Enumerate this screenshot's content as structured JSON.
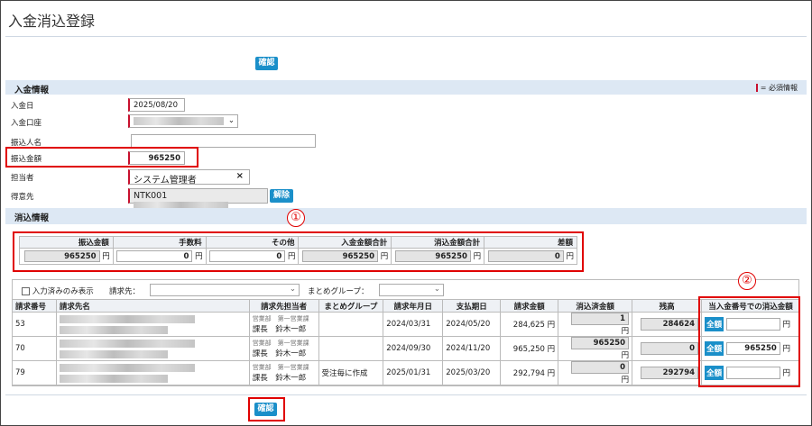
{
  "page_title": "入金消込登録",
  "confirm_label": "確認",
  "payment_section": {
    "title": "入金情報",
    "required_legend": "= 必須情報",
    "fields": {
      "date_label": "入金日",
      "date_value": "2025/08/20",
      "account_label": "入金口座",
      "payer_label": "振込人名",
      "amount_label": "振込金額",
      "amount_value": "965250",
      "staff_label": "担当者",
      "staff_value": "システム管理者",
      "staff_clear": "×",
      "customer_label": "得意先",
      "customer_code": "NTK001",
      "release_label": "解除"
    }
  },
  "clearing_section": {
    "title": "消込情報",
    "summary": {
      "headers": [
        "振込金額",
        "手数料",
        "その他",
        "入金金額合計",
        "消込金額合計",
        "差額"
      ],
      "values": [
        "965250",
        "0",
        "0",
        "965250",
        "965250",
        "0"
      ],
      "unit": "円"
    },
    "filters": {
      "only_entered_label": "入力済みのみ表示",
      "billing_to_label": "請求先：",
      "group_label": "まとめグループ："
    },
    "columns": [
      "請求番号",
      "請求先名",
      "請求先担当者",
      "まとめグループ",
      "請求年月日",
      "支払期日",
      "請求金額",
      "消込済金額",
      "残高",
      "当入金番号での消込金額"
    ],
    "rows": [
      {
        "no": "53",
        "dept": "営業部　第一営業課",
        "person": "課長　鈴木一郎",
        "group": "",
        "bill_date": "2024/03/31",
        "due_date": "2024/05/20",
        "amount": "284,625 円",
        "cleared": "1",
        "balance": "284624",
        "this_amount": ""
      },
      {
        "no": "70",
        "dept": "営業部　第一営業課",
        "person": "課長　鈴木一郎",
        "group": "",
        "bill_date": "2024/09/30",
        "due_date": "2024/11/20",
        "amount": "965,250 円",
        "cleared": "965250",
        "balance": "0",
        "this_amount": "965250"
      },
      {
        "no": "79",
        "dept": "営業部　第一営業課",
        "person": "課長　鈴木一郎",
        "group": "受注毎に作成",
        "bill_date": "2025/01/31",
        "due_date": "2025/03/20",
        "amount": "292,794 円",
        "cleared": "0",
        "balance": "292794",
        "this_amount": ""
      }
    ],
    "full_amount_label": "全額",
    "unit": "円"
  },
  "annotations": [
    "①",
    "②"
  ]
}
